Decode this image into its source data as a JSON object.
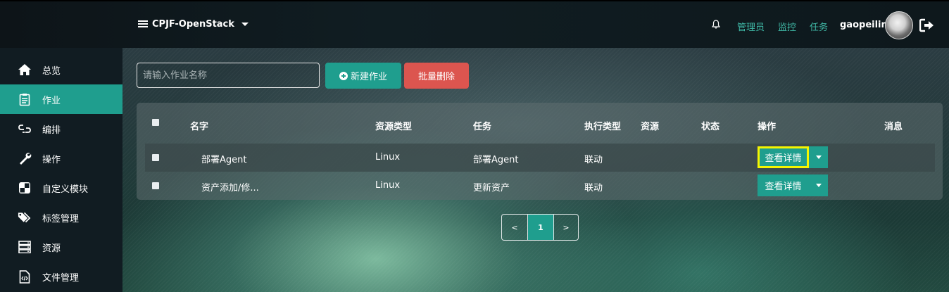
{
  "header": {
    "project": "CPJF-OpenStack",
    "links": [
      "管理员",
      "监控",
      "任务"
    ],
    "username": "gaopeilin"
  },
  "sidebar": {
    "items": [
      {
        "label": "总览",
        "icon": "home-icon"
      },
      {
        "label": "作业",
        "icon": "clipboard-icon",
        "active": true
      },
      {
        "label": "编排",
        "icon": "link-icon"
      },
      {
        "label": "操作",
        "icon": "wrench-icon"
      },
      {
        "label": "自定义模块",
        "icon": "quadrant-icon"
      },
      {
        "label": "标签管理",
        "icon": "tags-icon"
      },
      {
        "label": "资源",
        "icon": "server-icon"
      },
      {
        "label": "文件管理",
        "icon": "file-code-icon"
      }
    ]
  },
  "toolbar": {
    "search_placeholder": "请输入作业名称",
    "new_label": "新建作业",
    "delete_label": "批量删除"
  },
  "table": {
    "headers": [
      "名字",
      "资源类型",
      "任务",
      "执行类型",
      "资源",
      "状态",
      "操作",
      "消息"
    ],
    "rows": [
      {
        "name": "部署Agent",
        "resource_type": "Linux",
        "task": "部署Agent",
        "exec_type": "联动",
        "resource": "",
        "status": "",
        "action": "查看详情",
        "message": ""
      },
      {
        "name": "资产添加/修...",
        "resource_type": "Linux",
        "task": "更新资产",
        "exec_type": "联动",
        "resource": "",
        "status": "",
        "action": "查看详情",
        "message": ""
      }
    ]
  },
  "pagination": {
    "prev": "<",
    "current": "1",
    "next": ">"
  },
  "colors": {
    "accent": "#1f9e8e",
    "danger": "#dc554f",
    "link": "#3fb8a6",
    "focus_outline": "#f5f500"
  }
}
